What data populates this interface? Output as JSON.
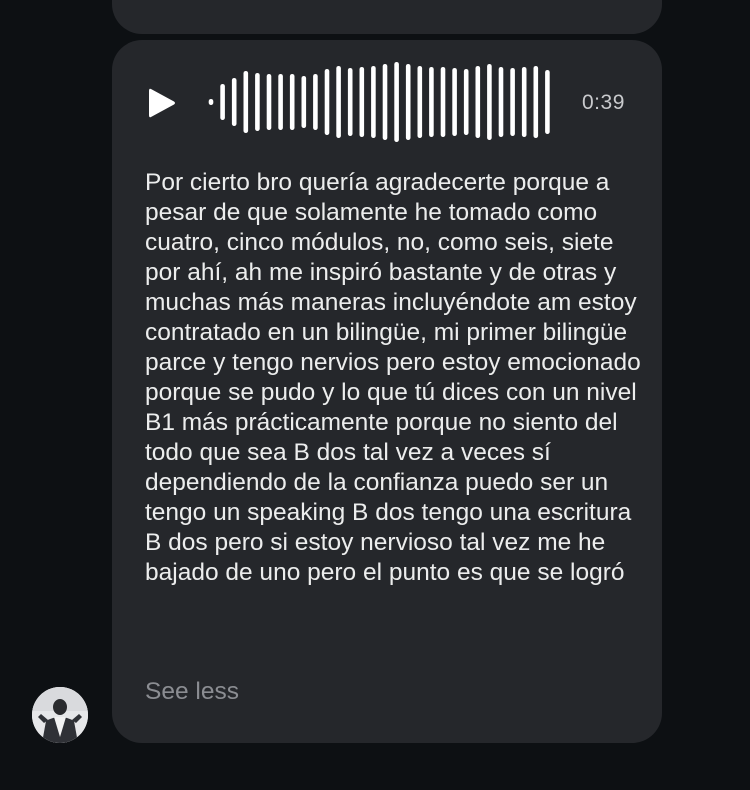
{
  "message": {
    "voice_note": {
      "play_icon": "play-icon",
      "duration": "0:39"
    },
    "transcript": "Por cierto bro quería agradecerte porque a pesar de que solamente he tomado como cuatro, cinco módulos, no, como seis, siete por ahí, ah me inspiró bastante y de otras y muchas más maneras incluyéndote am estoy contratado en un bilingüe, mi primer bilingüe parce y tengo nervios pero estoy emocionado porque se pudo y lo que tú dices con un nivel B1 más prácticamente porque no siento del todo que sea B dos tal vez a veces sí dependiendo de la confianza puedo ser un tengo un speaking B dos tengo una escritura B dos pero si estoy nervioso tal vez me he bajado de uno pero el punto es que se logró",
    "see_less_label": "See less"
  },
  "sender": {
    "avatar_icon": "user-avatar"
  },
  "colors": {
    "background": "#0d1013",
    "bubble": "#25272b",
    "text": "#eceded",
    "muted": "#8b8d92"
  }
}
